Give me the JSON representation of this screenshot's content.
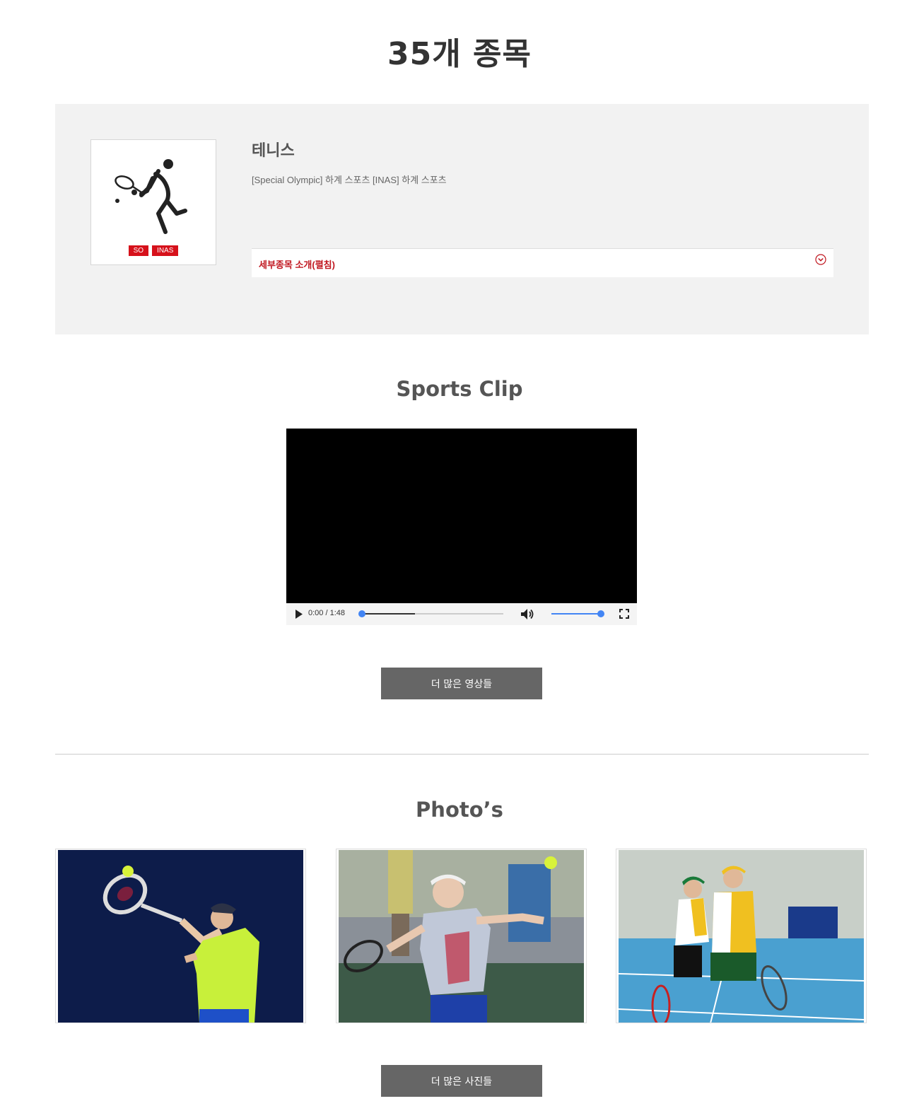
{
  "page": {
    "title": "35개 종목"
  },
  "sport": {
    "name": "테니스",
    "description": "[Special Olympic] 하계 스포츠 [INAS] 하계 스포츠",
    "badges": [
      "SO",
      "INAS"
    ],
    "icon": "tennis-player-icon",
    "accordion_label": "세부종목 소개(펼침)",
    "accordion_icon": "chevron-down-circle-icon"
  },
  "clip": {
    "title": "Sports Clip",
    "player": {
      "time": "0:00 / 1:48",
      "progress": 0,
      "volume": 1.0
    },
    "more_button": "더 많은 영상들"
  },
  "photos": {
    "title": "Photo’s",
    "more_button": "더 많은 사진들",
    "items": [
      {
        "alt": "tennis-photo-1"
      },
      {
        "alt": "tennis-photo-2"
      },
      {
        "alt": "tennis-photo-3"
      }
    ]
  },
  "colors": {
    "accent": "#d6111b",
    "button": "#666666",
    "panel": "#f2f2f2",
    "player_blue": "#4285f4"
  }
}
